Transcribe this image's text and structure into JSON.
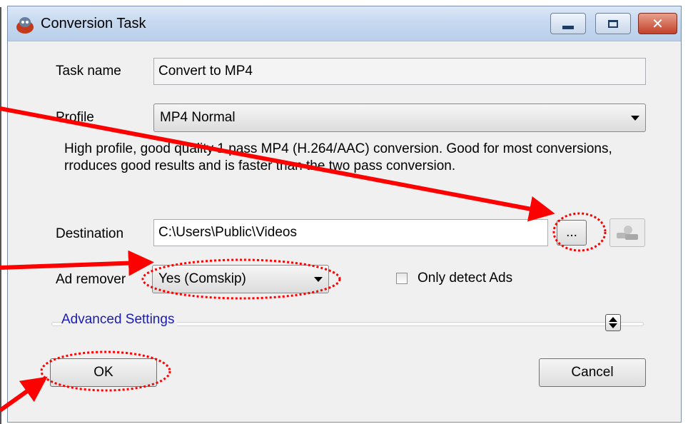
{
  "window": {
    "title": "Conversion Task",
    "app_icon": "app-icon",
    "controls": [
      "minimize-icon",
      "maximize-icon",
      "close-icon"
    ]
  },
  "form": {
    "task_name_label": "Task name",
    "task_name_value": "Convert to MP4",
    "profile_label": "Profile",
    "profile_value": "MP4 Normal",
    "profile_description": "High profile, good quality 1 pass MP4 (H.264/AAC) conversion. Good for most conversions, rroduces good results and is faster than the two pass conversion.",
    "destination_label": "Destination",
    "destination_value": "C:\\Users\\Public\\Videos",
    "browse_label": "...",
    "ad_remover_label": "Ad remover",
    "ad_remover_value": "Yes (Comskip)",
    "only_detect_ads_label": "Only detect Ads",
    "only_detect_ads_checked": false,
    "advanced_settings_label": "Advanced Settings"
  },
  "buttons": {
    "ok_label": "OK",
    "cancel_label": "Cancel"
  },
  "annotations": {
    "color": "#ff0000",
    "highlighted": [
      "browse-button",
      "ad-remover-dropdown",
      "ok-button"
    ]
  }
}
